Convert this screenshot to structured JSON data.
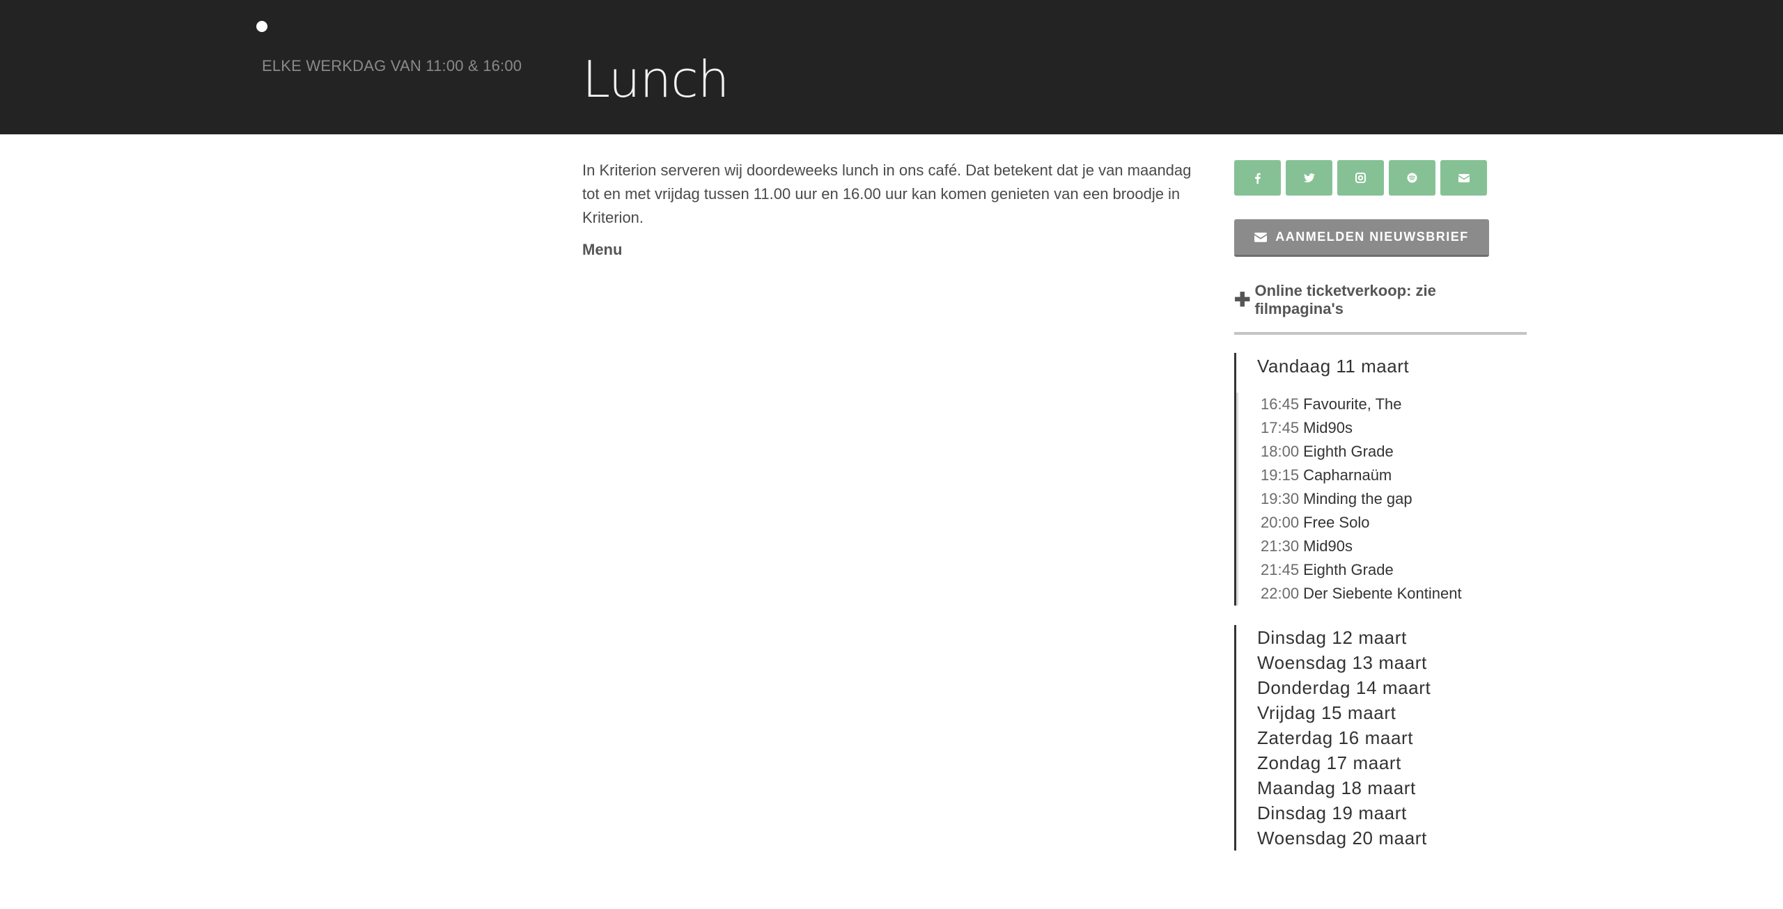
{
  "header": {
    "subtitle": "ELKE WERKDAG VAN 11:00 & 16:00",
    "title": "Lunch"
  },
  "content": {
    "paragraph": "In Kriterion serveren wij doordeweeks lunch in ons café. Dat betekent dat je van maandag tot en met vrijdag tussen 11.00 uur en 16.00 uur kan komen genieten van een broodje in Kriterion.",
    "menu_label": "Menu"
  },
  "sidebar": {
    "social": [
      {
        "name": "facebook-icon",
        "glyph": "f"
      },
      {
        "name": "twitter-icon",
        "glyph": "🐦"
      },
      {
        "name": "instagram-icon",
        "glyph": "◘"
      },
      {
        "name": "spotify-icon",
        "glyph": "●"
      },
      {
        "name": "mail-icon",
        "glyph": "✉"
      }
    ],
    "newsletter_label": "AANMELDEN NIEUWSBRIEF",
    "ticket_text": "Online ticketverkoop: zie filmpagina's",
    "today": {
      "heading": "Vandaag 11 maart",
      "screenings": [
        {
          "time": "16:45",
          "title": "Favourite, The"
        },
        {
          "time": "17:45",
          "title": "Mid90s"
        },
        {
          "time": "18:00",
          "title": "Eighth Grade"
        },
        {
          "time": "19:15",
          "title": "Capharnaüm"
        },
        {
          "time": "19:30",
          "title": "Minding the gap"
        },
        {
          "time": "20:00",
          "title": "Free Solo"
        },
        {
          "time": "21:30",
          "title": "Mid90s"
        },
        {
          "time": "21:45",
          "title": "Eighth Grade"
        },
        {
          "time": "22:00",
          "title": "Der Siebente Kontinent"
        }
      ]
    },
    "days": [
      "Dinsdag 12 maart",
      "Woensdag 13 maart",
      "Donderdag 14 maart",
      "Vrijdag 15 maart",
      "Zaterdag 16 maart",
      "Zondag 17 maart",
      "Maandag 18 maart",
      "Dinsdag 19 maart",
      "Woensdag 20 maart"
    ]
  },
  "colors": {
    "header_bg": "#232323",
    "social_green": "#86c195",
    "newsletter_gray": "#8b8b8b"
  }
}
